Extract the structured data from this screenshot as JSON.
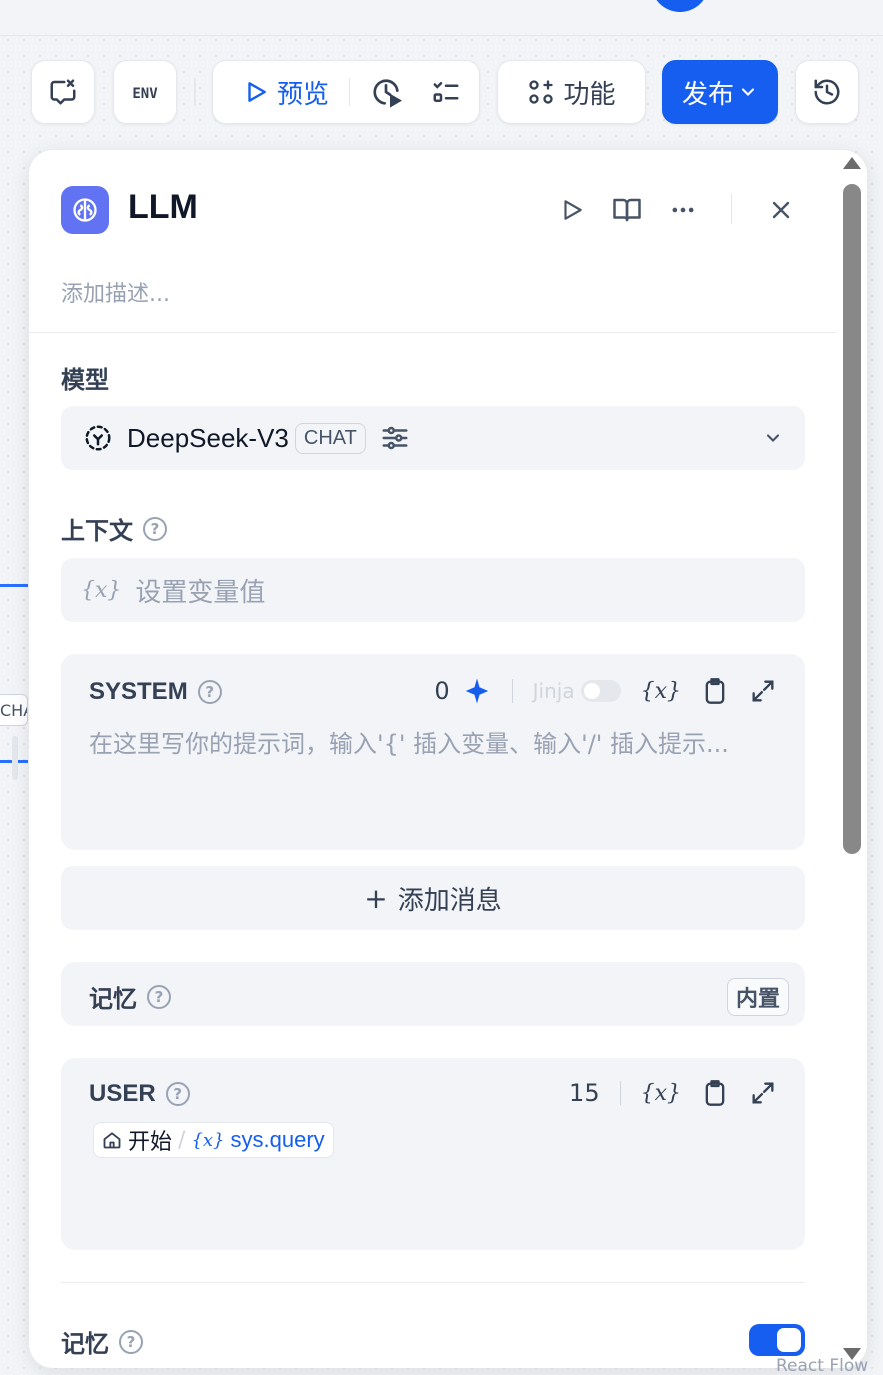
{
  "toolbar": {
    "preview_label": "预览",
    "features_label": "功能",
    "publish_label": "发布"
  },
  "canvas": {
    "edge_tag_text": "CHA",
    "footer_text": "React Flow"
  },
  "node": {
    "title": "LLM",
    "description_placeholder": "添加描述..."
  },
  "model": {
    "section_label": "模型",
    "name": "DeepSeek-V3",
    "mode_badge": "CHAT"
  },
  "context": {
    "section_label": "上下文",
    "placeholder": "设置变量值"
  },
  "system_prompt": {
    "role": "SYSTEM",
    "count": "0",
    "jinja_label": "Jinja",
    "placeholder": "在这里写你的提示词，输入'{' 插入变量、输入'/' 插入提示..."
  },
  "add_message_label": "添加消息",
  "memory_card": {
    "label": "记忆",
    "badge": "内置"
  },
  "user_prompt": {
    "role": "USER",
    "count": "15",
    "var_node": "开始",
    "var_name": "sys.query"
  },
  "memory_setting": {
    "label": "记忆",
    "enabled": true
  },
  "colors": {
    "accent": "#155eef",
    "node_icon_bg": "#6172f3",
    "card_bg": "#f2f4f7"
  }
}
